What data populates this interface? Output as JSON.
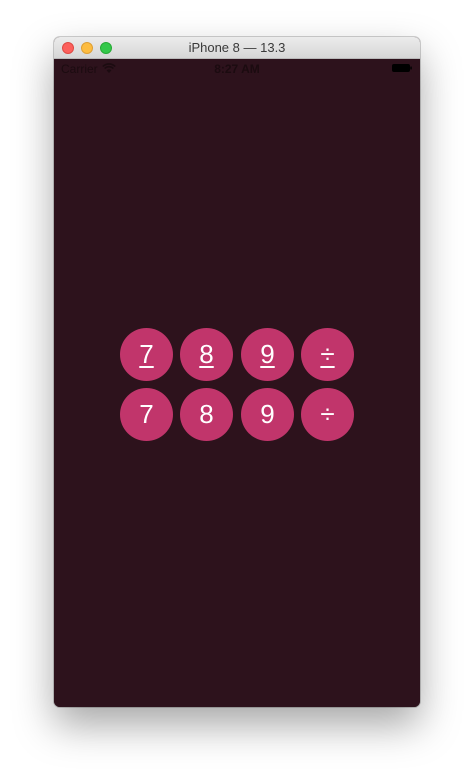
{
  "window": {
    "title": "iPhone 8 — 13.3"
  },
  "status_bar": {
    "carrier": "Carrier",
    "time": "8:27 AM"
  },
  "keypad": {
    "rows": [
      {
        "keys": [
          "7",
          "8",
          "9",
          "÷"
        ],
        "underlined": true
      },
      {
        "keys": [
          "7",
          "8",
          "9",
          "÷"
        ],
        "underlined": false
      }
    ]
  },
  "colors": {
    "background": "#2d121c",
    "key": "#c1356b",
    "key_text": "#ffffff"
  },
  "icons": [
    "close-button",
    "minimize-button",
    "zoom-button",
    "wifi-icon",
    "battery-icon"
  ]
}
